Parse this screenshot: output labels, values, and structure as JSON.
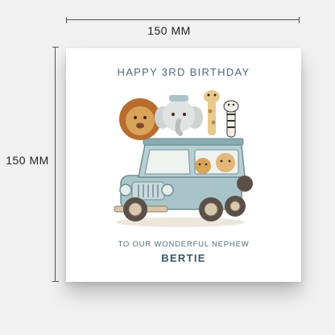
{
  "dimensions": {
    "width_label": "150 MM",
    "height_label": "150 MM"
  },
  "card": {
    "title": "Happy 3rd Birthday",
    "subtitle": "To Our Wonderful Nephew",
    "name": "Bertie"
  },
  "illustration": {
    "subject": "safari jeep with lion, elephant, giraffe and zebra",
    "colors": {
      "jeep": "#a9c4c8",
      "jeep_dark": "#6f8f96",
      "lion": "#d9a45a",
      "mane": "#b86c2e",
      "elephant": "#dfe3e2",
      "giraffe": "#e8c98f",
      "zebra": "#f1efe8",
      "tire": "#5a5048",
      "hub": "#d8c8b0"
    }
  }
}
